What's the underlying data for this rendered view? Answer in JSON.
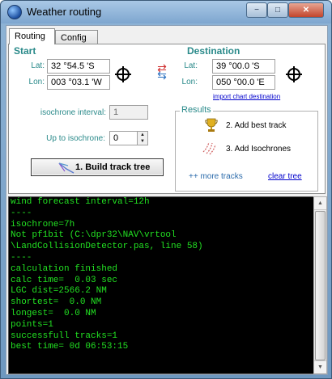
{
  "window": {
    "title": "Weather routing",
    "controls": {
      "minimize": "−",
      "maximize": "□",
      "close": "✕"
    }
  },
  "tabs": [
    {
      "label": "Routing",
      "active": true
    },
    {
      "label": "Config",
      "active": false
    }
  ],
  "start": {
    "heading": "Start",
    "lat_label": "Lat:",
    "lat_value": "32 °54.5 'S",
    "lon_label": "Lon:",
    "lon_value": "003 °03.1 'W"
  },
  "destination": {
    "heading": "Destination",
    "lat_label": "Lat:",
    "lat_value": "39 °00.0 'S",
    "lon_label": "Lon:",
    "lon_value": "050 °00.0 'E",
    "import_link": "import chart destination"
  },
  "isochrone": {
    "interval_label": "isochrone interval:",
    "interval_value": "1",
    "up_to_label": "Up to isochrone:",
    "up_to_value": "0"
  },
  "build_button": {
    "label": "1. Build track tree"
  },
  "results": {
    "legend": "Results",
    "add_best_track": "2. Add best track",
    "add_isochrones": "3. Add Isochrones",
    "more_tracks": "++ more tracks",
    "clear_tree": "clear tree"
  },
  "console": {
    "lines": [
      "wind forecast interval=12h",
      "----",
      "isochrone=7h",
      "Not pf1bit (C:\\dpr32\\NAV\\vrtool",
      "\\LandCollisionDetector.pas, line 58)",
      "----",
      "calculation finished",
      "calc time=  0.03 sec",
      "LGC dist=2566.2 NM",
      "shortest=  0.0 NM",
      "longest=  0.0 NM",
      "points=1",
      "successfull tracks=1",
      "best time= 0d 06:53:15"
    ],
    "colors": {
      "background": "#000000",
      "text": "#22e022"
    }
  },
  "accent_color": "#2a8a8a"
}
